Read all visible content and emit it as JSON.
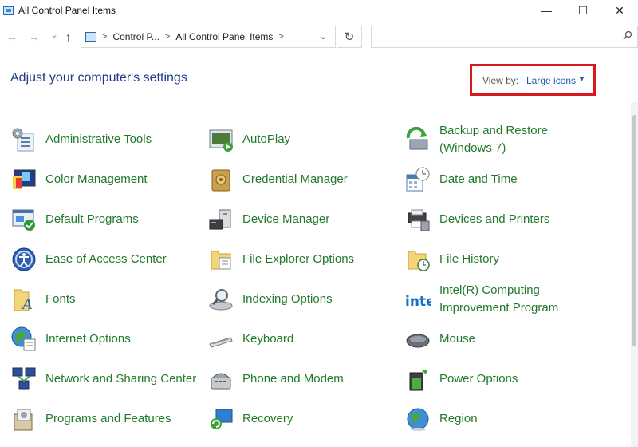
{
  "window": {
    "title": "All Control Panel Items",
    "minimize": "—",
    "maximize": "☐",
    "close": "✕"
  },
  "nav": {
    "back": "←",
    "forward": "→",
    "history": "⌄",
    "up": "↑",
    "breadcrumbs": [
      "Control P...",
      "All Control Panel Items"
    ],
    "refresh": "↻",
    "search_placeholder": ""
  },
  "header": {
    "title": "Adjust your computer's settings",
    "view_by_label": "View by:",
    "view_by_value": "Large icons"
  },
  "items": [
    {
      "label": "Administrative Tools",
      "icon": "admin-tools-icon"
    },
    {
      "label": "AutoPlay",
      "icon": "autoplay-icon"
    },
    {
      "label": "Backup and Restore (Windows 7)",
      "icon": "backup-restore-icon"
    },
    {
      "label": "Color Management",
      "icon": "color-management-icon"
    },
    {
      "label": "Credential Manager",
      "icon": "credential-manager-icon"
    },
    {
      "label": "Date and Time",
      "icon": "date-time-icon"
    },
    {
      "label": "Default Programs",
      "icon": "default-programs-icon"
    },
    {
      "label": "Device Manager",
      "icon": "device-manager-icon"
    },
    {
      "label": "Devices and Printers",
      "icon": "devices-printers-icon"
    },
    {
      "label": "Ease of Access Center",
      "icon": "ease-of-access-icon"
    },
    {
      "label": "File Explorer Options",
      "icon": "file-explorer-options-icon"
    },
    {
      "label": "File History",
      "icon": "file-history-icon"
    },
    {
      "label": "Fonts",
      "icon": "fonts-icon"
    },
    {
      "label": "Indexing Options",
      "icon": "indexing-options-icon"
    },
    {
      "label": "Intel(R) Computing Improvement Program",
      "icon": "intel-icon"
    },
    {
      "label": "Internet Options",
      "icon": "internet-options-icon"
    },
    {
      "label": "Keyboard",
      "icon": "keyboard-icon"
    },
    {
      "label": "Mouse",
      "icon": "mouse-icon"
    },
    {
      "label": "Network and Sharing Center",
      "icon": "network-sharing-icon"
    },
    {
      "label": "Phone and Modem",
      "icon": "phone-modem-icon"
    },
    {
      "label": "Power Options",
      "icon": "power-options-icon"
    },
    {
      "label": "Programs and Features",
      "icon": "programs-features-icon"
    },
    {
      "label": "Recovery",
      "icon": "recovery-icon"
    },
    {
      "label": "Region",
      "icon": "region-icon"
    }
  ]
}
